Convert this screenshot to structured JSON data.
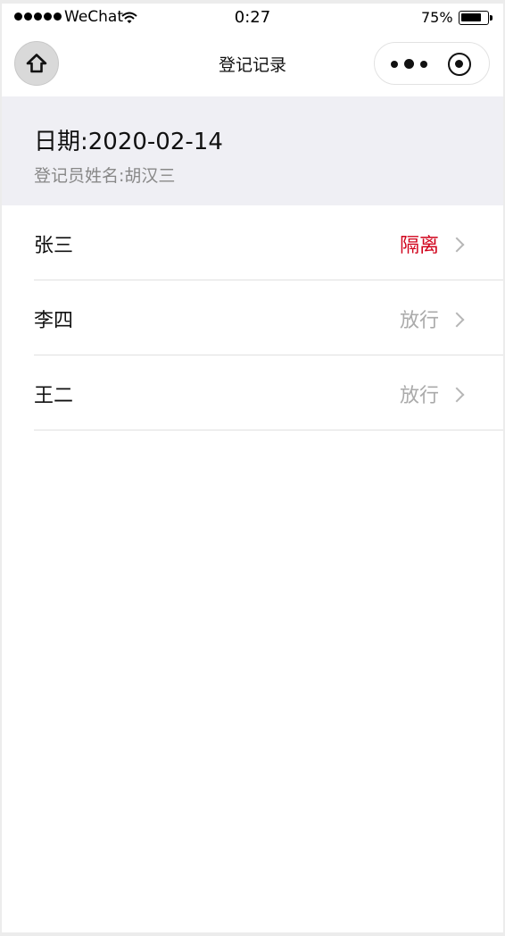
{
  "status_bar": {
    "carrier": "WeChat",
    "time": "0:27",
    "battery": "75%",
    "battery_level": 0.75
  },
  "nav": {
    "title": "登记记录"
  },
  "header": {
    "date": "日期:2020-02-14",
    "registrar": "登记员姓名:胡汉三"
  },
  "records": [
    {
      "name": "张三",
      "status": "隔离",
      "status_color": "#d0021b"
    },
    {
      "name": "李四",
      "status": "放行",
      "status_color": "#aaaaaa"
    },
    {
      "name": "王二",
      "status": "放行",
      "status_color": "#aaaaaa"
    }
  ]
}
